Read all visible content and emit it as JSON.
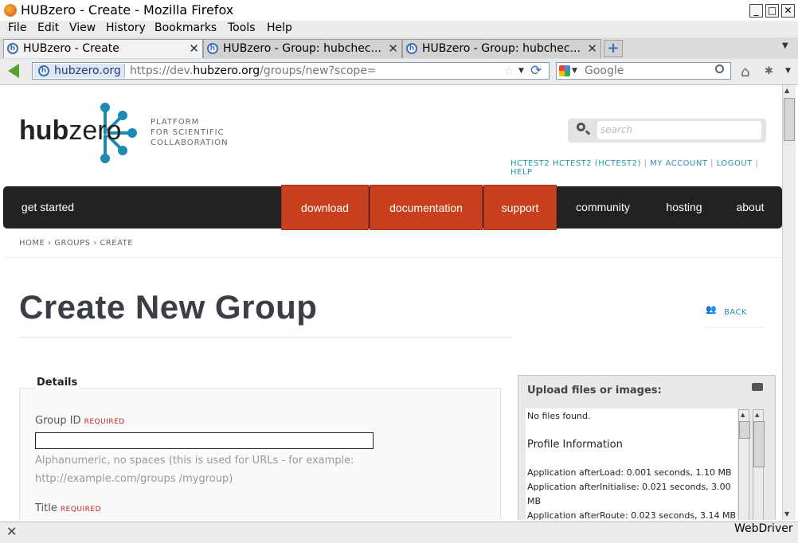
{
  "window": {
    "title": "HUBzero - Create - Mozilla Firefox"
  },
  "menubar": [
    "File",
    "Edit",
    "View",
    "History",
    "Bookmarks",
    "Tools",
    "Help"
  ],
  "tabs": [
    {
      "label": "HUBzero - Create",
      "active": true
    },
    {
      "label": "HUBzero - Group: hubchec...",
      "active": false
    },
    {
      "label": "HUBzero - Group: hubchec...",
      "active": false
    }
  ],
  "urlbar": {
    "identity": "hubzero.org",
    "url_prefix": "https://dev.",
    "url_domain": "hubzero.org",
    "url_suffix": "/groups/new?scope="
  },
  "searchbar": {
    "engine": "Google"
  },
  "status": {
    "text": "WebDriver"
  },
  "site": {
    "logo": {
      "bold": "hub",
      "light": "zero"
    },
    "tagline": [
      "PLATFORM",
      "FOR SCIENTIFIC",
      "COLLABORATION"
    ],
    "search_placeholder": "search",
    "user_links": [
      "HCTEST2 HCTEST2 (HCTEST2)",
      "MY ACCOUNT",
      "LOGOUT",
      "HELP"
    ],
    "nav": [
      "get started",
      "download",
      "documentation",
      "support",
      "community",
      "hosting",
      "about"
    ],
    "breadcrumb": [
      "HOME",
      "GROUPS",
      "CREATE"
    ],
    "page_title": "Create New Group",
    "back_label": "BACK"
  },
  "form": {
    "legend": "Details",
    "group_id_label": "Group ID",
    "required": "REQUIRED",
    "group_id_hint": "Alphanumeric, no spaces (this is used for URLs - for example: http://example.com/groups /mygroup)",
    "title_label": "Title"
  },
  "upload": {
    "title": "Upload files or images:",
    "no_files": "No files found.",
    "profile_heading": "Profile Information",
    "profile_lines": [
      "Application afterLoad: 0.001 seconds, 1.10 MB",
      "Application afterInitialise: 0.021 seconds, 3.00",
      "MB",
      "Application afterRoute: 0.023 seconds, 3.14 MB"
    ]
  }
}
